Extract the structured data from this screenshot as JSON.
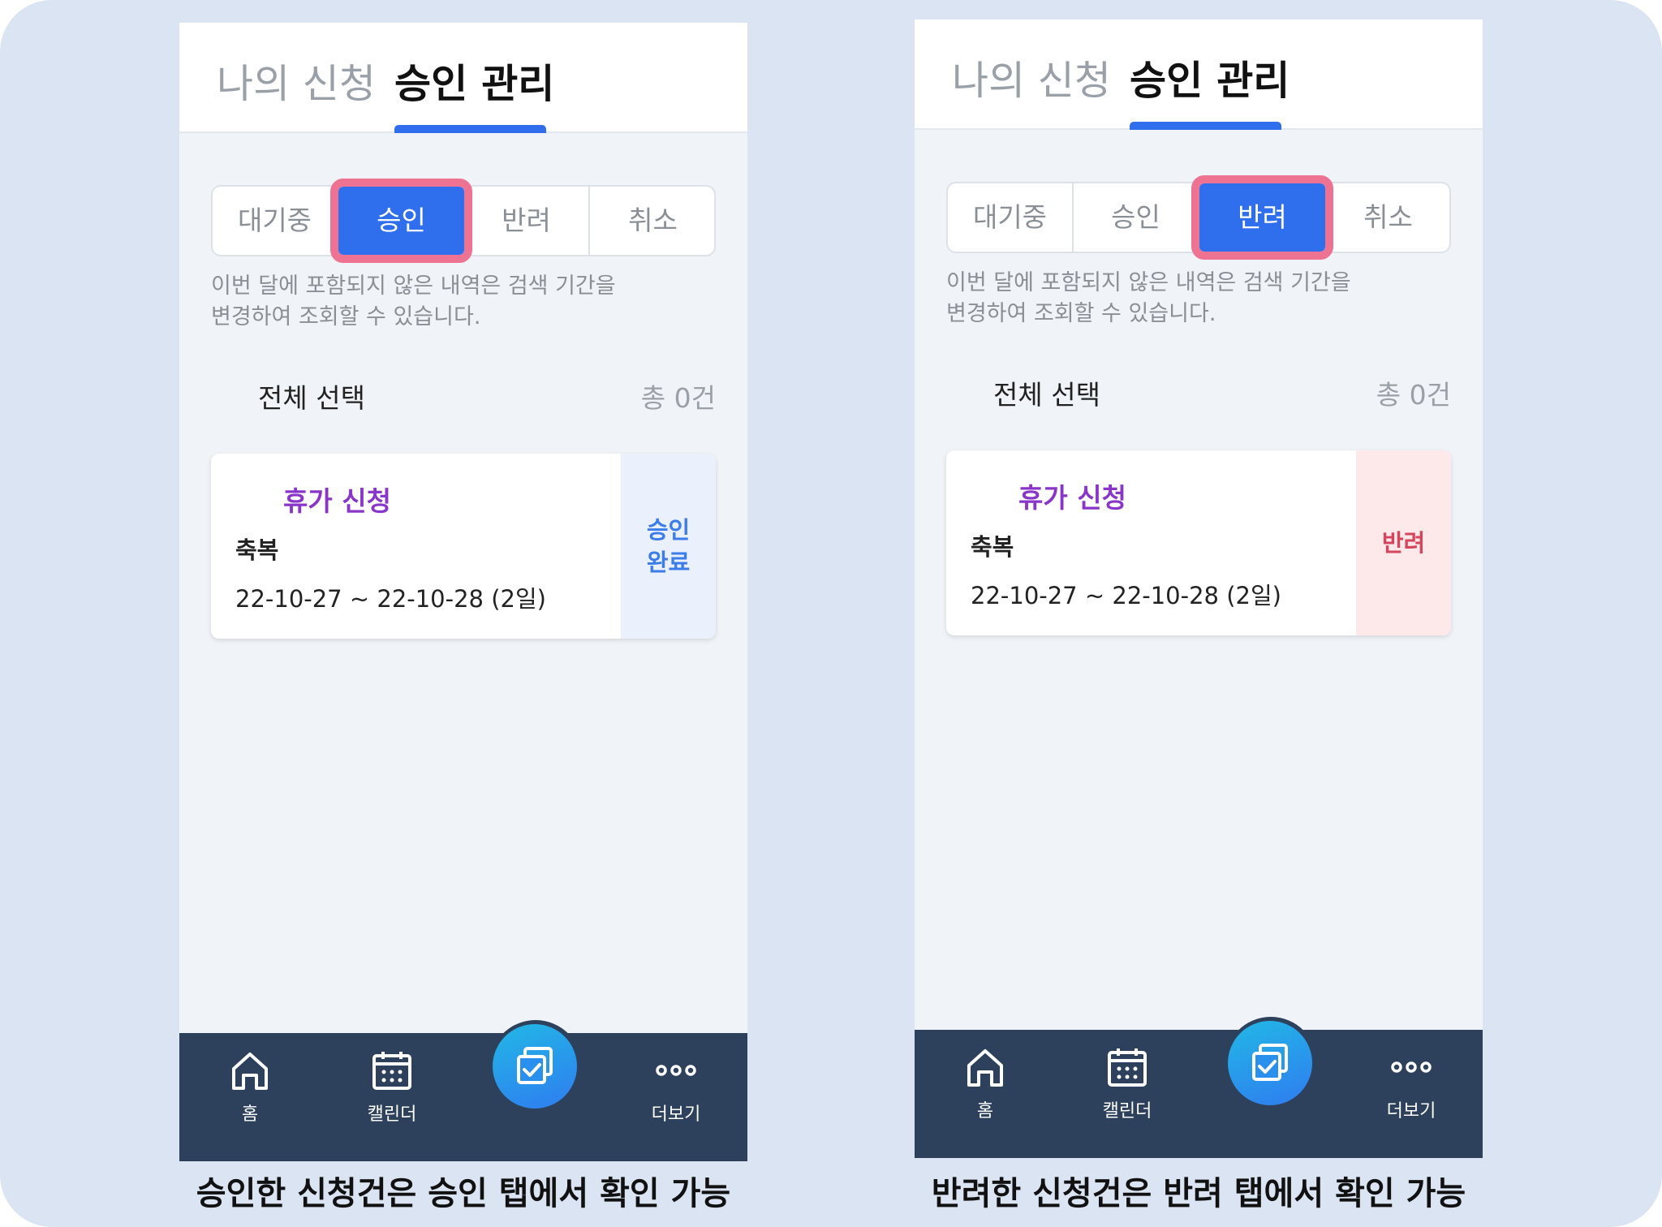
{
  "panels": [
    {
      "header": {
        "tab_my_requests": "나의 신청",
        "tab_approval": "승인 관리"
      },
      "filters": [
        "대기중",
        "승인",
        "반려",
        "취소"
      ],
      "selected_filter": "승인",
      "notice": {
        "line1": "이번 달에 포함되지 않은 내역은 검색 기간을",
        "line2": "변경하여 조회할 수 있습니다."
      },
      "select_all": "전체 선택",
      "total": "총 0건",
      "card": {
        "type": "휴가 신청",
        "reason": "축복",
        "dates": "22-10-27 ~ 22-10-28 (2일)",
        "status_line1": "승인",
        "status_line2": "완료",
        "status_color": "#3b7dea"
      },
      "caption": "승인한 신청건은 승인 탭에서 확인 가능"
    },
    {
      "header": {
        "tab_my_requests": "나의 신청",
        "tab_approval": "승인 관리"
      },
      "filters": [
        "대기중",
        "승인",
        "반려",
        "취소"
      ],
      "selected_filter": "반려",
      "notice": {
        "line1": "이번 달에 포함되지 않은 내역은 검색 기간을",
        "line2": "변경하여 조회할 수 있습니다."
      },
      "select_all": "전체 선택",
      "total": "총 0건",
      "card": {
        "type": "휴가 신청",
        "reason": "축복",
        "dates": "22-10-27 ~ 22-10-28 (2일)",
        "status_line1": "반려",
        "status_color": "#d5465c"
      },
      "caption": "반려한 신청건은 반려 탭에서 확인 가능"
    }
  ],
  "bottom_nav": {
    "home": "홈",
    "calendar": "캘린더",
    "more": "더보기",
    "icons": [
      "home-icon",
      "calendar-icon",
      "approval-check-icon",
      "more-dots-icon"
    ]
  },
  "colors": {
    "accent": "#2f6fee",
    "highlight_outline": "#ee7393",
    "nav_bg": "#2d405c",
    "card_type": "#8a35c9"
  }
}
